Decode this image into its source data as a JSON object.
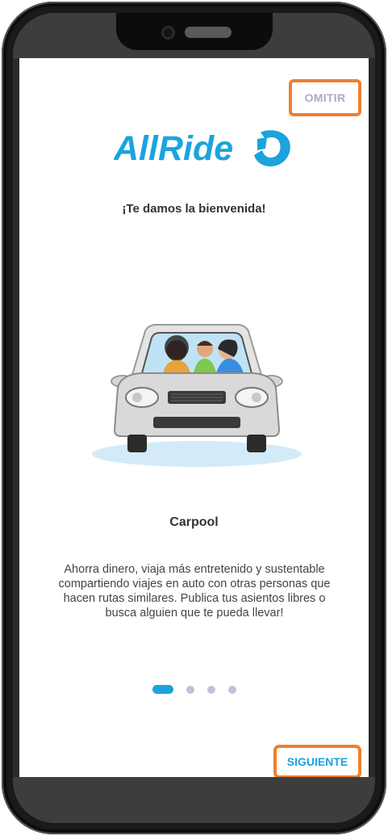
{
  "app": {
    "logo_text": "AllRide"
  },
  "header": {
    "skip_label": "OMITIR"
  },
  "welcome": {
    "title": "¡Te damos la bienvenida!"
  },
  "slide": {
    "title": "Carpool",
    "description": "Ahorra dinero, viaja más entretenido y sustentable compartiendo viajes en auto con otras personas que hacen rutas similares. Publica tus asientos libres o busca alguien que te pueda llevar!",
    "illustration": "carpool-car-illustration"
  },
  "pager": {
    "count": 4,
    "active_index": 0
  },
  "footer": {
    "next_label": "SIGUIENTE"
  },
  "colors": {
    "brand_blue": "#1ba3de",
    "highlight_orange": "#f07f2e",
    "skip_text": "#b0a9c2",
    "dot_inactive": "#c4c0d5"
  }
}
